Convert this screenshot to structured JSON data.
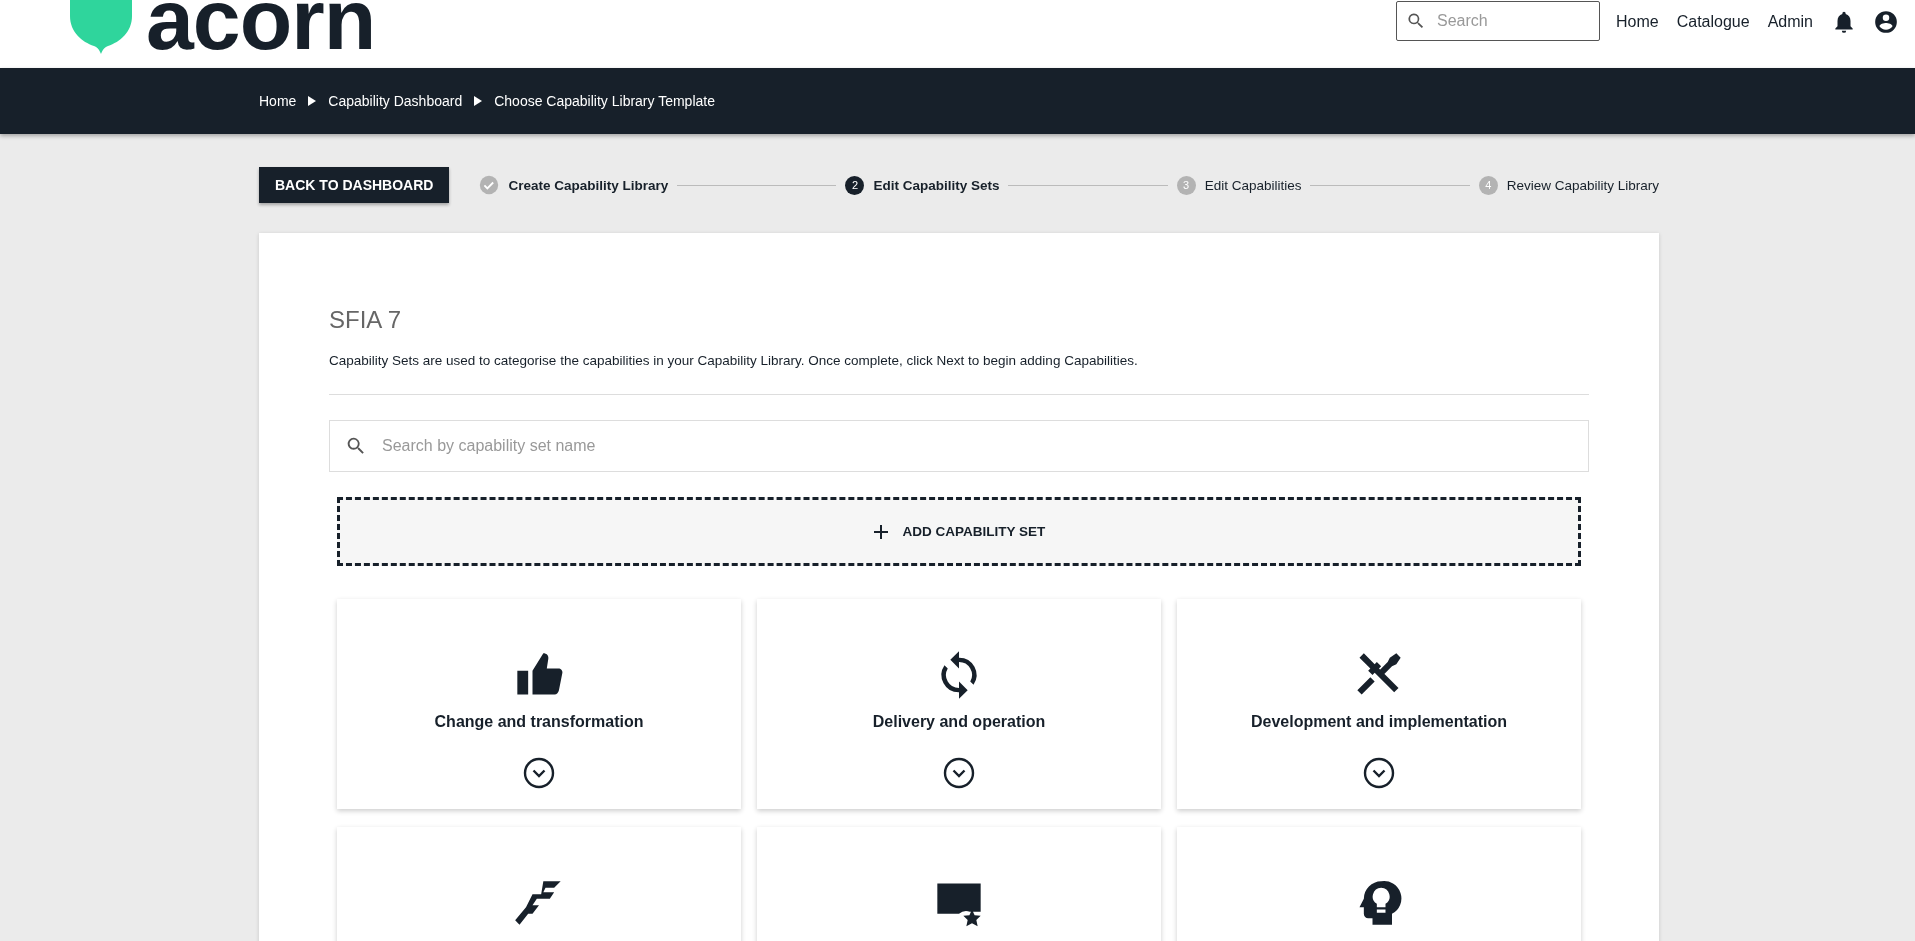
{
  "header": {
    "logo": "acorn",
    "search": {
      "placeholder": "Search"
    },
    "nav": [
      "Home",
      "Catalogue",
      "Admin"
    ]
  },
  "breadcrumbs": [
    "Home",
    "Capability Dashboard",
    "Choose Capability Library Template"
  ],
  "back_button": "BACK TO DASHBOARD",
  "stepper": [
    {
      "label": "Create Capability Library",
      "completed": true,
      "selected": false
    },
    {
      "number": "2",
      "label": "Edit Capability Sets",
      "completed": false,
      "selected": true
    },
    {
      "number": "3",
      "label": "Edit Capabilities",
      "completed": false,
      "selected": false
    },
    {
      "number": "4",
      "label": "Review Capability Library",
      "completed": false,
      "selected": false
    }
  ],
  "panel": {
    "title": "SFIA 7",
    "description": "Capability Sets are used to categorise the capabilities in your Capability Library. Once complete, click Next to begin adding Capabilities.",
    "search": {
      "placeholder": "Search by capability set name"
    },
    "add_button": "ADD CAPABILITY SET",
    "cards": [
      {
        "kind": "full",
        "title": "Change and transformation"
      },
      {
        "kind": "full",
        "title": "Delivery and operation"
      },
      {
        "kind": "full",
        "title": "Development and implementation"
      },
      {
        "kind": "cut"
      },
      {
        "kind": "cut"
      },
      {
        "kind": "cut"
      }
    ]
  }
}
